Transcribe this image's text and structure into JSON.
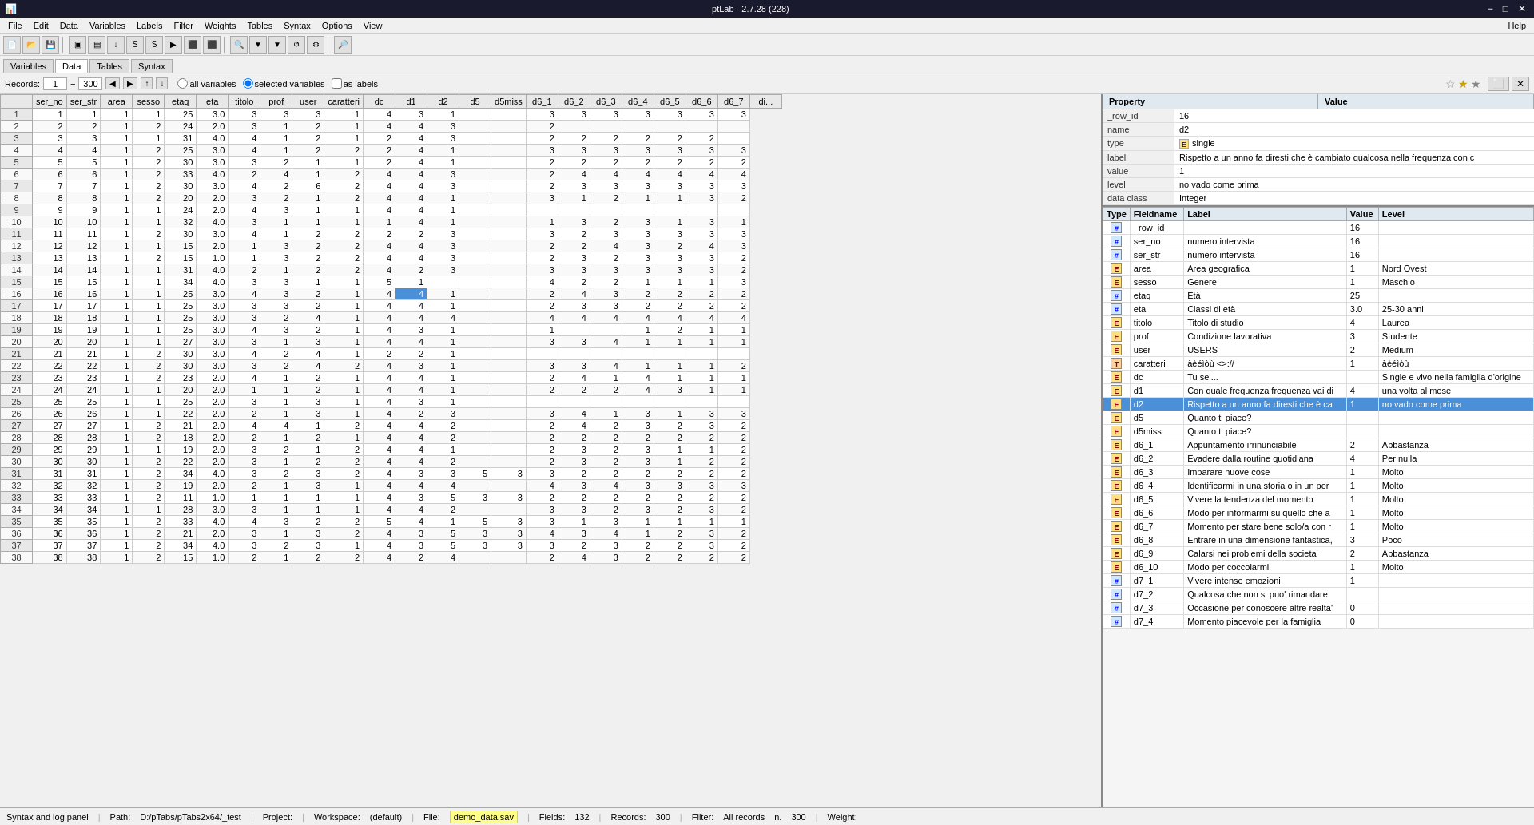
{
  "titlebar": {
    "title": "ptLab - 2.7.28 (228)",
    "minimize": "−",
    "maximize": "□",
    "close": "✕"
  },
  "menu": {
    "items": [
      "File",
      "Edit",
      "Data",
      "Variables",
      "Labels",
      "Filter",
      "Weights",
      "Tables",
      "Syntax",
      "Options",
      "View"
    ],
    "help": "Help"
  },
  "tabs": [
    "Variables",
    "Data",
    "Tables",
    "Syntax"
  ],
  "active_tab": "Data",
  "records": {
    "label": "Records:",
    "from": "1",
    "to": "300",
    "radio_all": "all variables",
    "radio_selected": "selected variables",
    "radio_labels": "as labels"
  },
  "columns": [
    "ser_no",
    "ser_str",
    "area",
    "sesso",
    "etaq",
    "eta",
    "titolo",
    "prof",
    "user",
    "caratteri",
    "dc",
    "d1",
    "d2",
    "d5",
    "d5miss",
    "d6_1",
    "d6_2",
    "d6_3",
    "d6_4",
    "d6_5",
    "d6_6",
    "d6_7",
    "di..."
  ],
  "property_panel": {
    "headers": [
      "Property",
      "Value"
    ],
    "rows": [
      {
        "key": "_row_id",
        "value": "16"
      },
      {
        "key": "name",
        "value": "d2"
      },
      {
        "key": "type",
        "value": "single"
      },
      {
        "key": "label",
        "value": "Rispetto a un anno fa diresti che è cambiato qualcosa nella frequenza con c"
      },
      {
        "key": "value",
        "value": "1"
      },
      {
        "key": "level",
        "value": "no vado come prima"
      },
      {
        "key": "data class",
        "value": "Integer"
      }
    ],
    "type_icon_color": "#ffe080"
  },
  "var_table": {
    "headers": [
      "Type",
      "Fieldname",
      "Label",
      "Value",
      "Level"
    ],
    "rows": [
      {
        "type": "#",
        "fieldname": "_row_id",
        "label": "",
        "value": "16",
        "level": "",
        "selected": false
      },
      {
        "type": "#",
        "fieldname": "ser_no",
        "label": "numero intervista",
        "value": "16",
        "level": "",
        "selected": false
      },
      {
        "type": "#",
        "fieldname": "ser_str",
        "label": "numero intervista",
        "value": "16",
        "level": "",
        "selected": false
      },
      {
        "type": "E",
        "fieldname": "area",
        "label": "Area geografica",
        "value": "1",
        "level": "Nord Ovest",
        "selected": false
      },
      {
        "type": "E",
        "fieldname": "sesso",
        "label": "Genere",
        "value": "1",
        "level": "Maschio",
        "selected": false
      },
      {
        "type": "#",
        "fieldname": "etaq",
        "label": "Età",
        "value": "25",
        "level": "",
        "selected": false
      },
      {
        "type": "#",
        "fieldname": "eta",
        "label": "Classi di età",
        "value": "3.0",
        "level": "25-30 anni",
        "selected": false
      },
      {
        "type": "E",
        "fieldname": "titolo",
        "label": "Titolo di studio",
        "value": "4",
        "level": "Laurea",
        "selected": false
      },
      {
        "type": "E",
        "fieldname": "prof",
        "label": "Condizione lavorativa",
        "value": "3",
        "level": "Studente",
        "selected": false
      },
      {
        "type": "E",
        "fieldname": "user",
        "label": "USERS",
        "value": "2",
        "level": "Medium",
        "selected": false
      },
      {
        "type": "T",
        "fieldname": "caratteri",
        "label": "àèéìòù <>://",
        "value": "1",
        "level": "àèéìòù",
        "selected": false
      },
      {
        "type": "E",
        "fieldname": "dc",
        "label": "Tu sei...",
        "value": "",
        "level": "Single e vivo nella famiglia d'origine",
        "selected": false
      },
      {
        "type": "E",
        "fieldname": "d1",
        "label": "Con quale frequenza frequenza vai di",
        "value": "4",
        "level": "una volta al mese",
        "selected": false
      },
      {
        "type": "E",
        "fieldname": "d2",
        "label": "Rispetto a un anno fa diresti che è ca",
        "value": "1",
        "level": "no vado come prima",
        "selected": true
      },
      {
        "type": "E",
        "fieldname": "d5",
        "label": "Quanto ti piace?",
        "value": "",
        "level": "",
        "selected": false
      },
      {
        "type": "E",
        "fieldname": "d5miss",
        "label": "Quanto ti piace?",
        "value": "",
        "level": "",
        "selected": false
      },
      {
        "type": "E",
        "fieldname": "d6_1",
        "label": "Appuntamento irrinunciabile",
        "value": "2",
        "level": "Abbastanza",
        "selected": false
      },
      {
        "type": "E",
        "fieldname": "d6_2",
        "label": "Evadere dalla routine quotidiana",
        "value": "4",
        "level": "Per nulla",
        "selected": false
      },
      {
        "type": "E",
        "fieldname": "d6_3",
        "label": "Imparare nuove cose",
        "value": "1",
        "level": "Molto",
        "selected": false
      },
      {
        "type": "E",
        "fieldname": "d6_4",
        "label": "Identificarmi in una storia o in un per",
        "value": "1",
        "level": "Molto",
        "selected": false
      },
      {
        "type": "E",
        "fieldname": "d6_5",
        "label": "Vivere la tendenza del momento",
        "value": "1",
        "level": "Molto",
        "selected": false
      },
      {
        "type": "E",
        "fieldname": "d6_6",
        "label": "Modo per informarmi su quello che a",
        "value": "1",
        "level": "Molto",
        "selected": false
      },
      {
        "type": "E",
        "fieldname": "d6_7",
        "label": "Momento per stare bene solo/a con r",
        "value": "1",
        "level": "Molto",
        "selected": false
      },
      {
        "type": "E",
        "fieldname": "d6_8",
        "label": "Entrare in una dimensione fantastica,",
        "value": "3",
        "level": "Poco",
        "selected": false
      },
      {
        "type": "E",
        "fieldname": "d6_9",
        "label": "Calarsi nei problemi della societa'",
        "value": "2",
        "level": "Abbastanza",
        "selected": false
      },
      {
        "type": "E",
        "fieldname": "d6_10",
        "label": "Modo per coccolarmi",
        "value": "1",
        "level": "Molto",
        "selected": false
      },
      {
        "type": "#",
        "fieldname": "d7_1",
        "label": "Vivere intense emozioni",
        "value": "1",
        "level": "",
        "selected": false
      },
      {
        "type": "#",
        "fieldname": "d7_2",
        "label": "Qualcosa che non si puo' rimandare",
        "value": "",
        "level": "",
        "selected": false
      },
      {
        "type": "#",
        "fieldname": "d7_3",
        "label": "Occasione per conoscere altre realta'",
        "value": "0",
        "level": "",
        "selected": false
      },
      {
        "type": "#",
        "fieldname": "d7_4",
        "label": "Momento piacevole per la famiglia",
        "value": "0",
        "level": "",
        "selected": false
      }
    ]
  },
  "data_rows": [
    [
      1,
      1,
      1,
      1,
      25,
      "3.0",
      3,
      3,
      3,
      1,
      4,
      3,
      1,
      "",
      "",
      3,
      3,
      3,
      3,
      3,
      3,
      3
    ],
    [
      2,
      2,
      1,
      2,
      24,
      "2.0",
      3,
      1,
      2,
      1,
      4,
      4,
      3,
      "",
      "",
      2,
      "",
      "",
      "",
      "",
      "",
      ""
    ],
    [
      3,
      3,
      1,
      1,
      31,
      "4.0",
      4,
      1,
      2,
      1,
      2,
      4,
      3,
      "",
      "",
      2,
      2,
      2,
      2,
      2,
      2,
      ""
    ],
    [
      4,
      4,
      1,
      2,
      25,
      "3.0",
      4,
      1,
      2,
      2,
      2,
      4,
      1,
      "",
      "",
      3,
      3,
      3,
      3,
      3,
      3,
      3
    ],
    [
      5,
      5,
      1,
      2,
      30,
      "3.0",
      3,
      2,
      1,
      1,
      2,
      4,
      1,
      "",
      "",
      2,
      2,
      2,
      2,
      2,
      2,
      2
    ],
    [
      6,
      6,
      1,
      2,
      33,
      "4.0",
      2,
      4,
      1,
      2,
      4,
      4,
      3,
      "",
      "",
      2,
      4,
      4,
      4,
      4,
      4,
      4
    ],
    [
      7,
      7,
      1,
      2,
      30,
      "3.0",
      4,
      2,
      6,
      2,
      4,
      4,
      3,
      "",
      "",
      2,
      3,
      3,
      3,
      3,
      3,
      3
    ],
    [
      8,
      8,
      1,
      2,
      20,
      "2.0",
      3,
      2,
      1,
      2,
      4,
      4,
      1,
      "",
      "",
      3,
      1,
      2,
      1,
      1,
      3,
      2
    ],
    [
      9,
      9,
      1,
      1,
      24,
      "2.0",
      4,
      3,
      1,
      1,
      4,
      4,
      1,
      "",
      "",
      "",
      "",
      "",
      "",
      "",
      "",
      ""
    ],
    [
      10,
      10,
      1,
      1,
      32,
      "4.0",
      3,
      1,
      1,
      1,
      1,
      4,
      1,
      "",
      "",
      1,
      3,
      2,
      3,
      1,
      3,
      1
    ],
    [
      11,
      11,
      1,
      2,
      30,
      "3.0",
      4,
      1,
      2,
      2,
      2,
      2,
      3,
      "",
      "",
      3,
      2,
      3,
      3,
      3,
      3,
      3
    ],
    [
      12,
      12,
      1,
      1,
      15,
      "2.0",
      1,
      3,
      2,
      2,
      4,
      4,
      3,
      "",
      "",
      2,
      2,
      4,
      3,
      2,
      4,
      3
    ],
    [
      13,
      13,
      1,
      2,
      15,
      "1.0",
      1,
      3,
      2,
      2,
      4,
      4,
      3,
      "",
      "",
      2,
      3,
      2,
      3,
      3,
      3,
      2
    ],
    [
      14,
      14,
      1,
      1,
      31,
      "4.0",
      2,
      1,
      2,
      2,
      4,
      2,
      3,
      "",
      "",
      3,
      3,
      3,
      3,
      3,
      3,
      2
    ],
    [
      15,
      15,
      1,
      1,
      34,
      "4.0",
      3,
      3,
      1,
      1,
      5,
      1,
      "",
      "",
      "",
      4,
      2,
      2,
      1,
      1,
      1,
      3
    ],
    [
      16,
      16,
      1,
      1,
      25,
      "3.0",
      4,
      3,
      2,
      1,
      4,
      4,
      1,
      "",
      "",
      2,
      4,
      3,
      2,
      2,
      2,
      2
    ],
    [
      17,
      17,
      1,
      1,
      25,
      "3.0",
      3,
      3,
      2,
      1,
      4,
      4,
      1,
      "",
      "",
      2,
      3,
      3,
      2,
      2,
      2,
      2
    ],
    [
      18,
      18,
      1,
      1,
      25,
      "3.0",
      3,
      2,
      4,
      1,
      4,
      4,
      4,
      "",
      "",
      4,
      4,
      4,
      4,
      4,
      4,
      4
    ],
    [
      19,
      19,
      1,
      1,
      25,
      "3.0",
      4,
      3,
      2,
      1,
      4,
      3,
      1,
      "",
      "",
      1,
      "",
      "",
      1,
      2,
      1,
      1
    ],
    [
      20,
      20,
      1,
      1,
      27,
      "3.0",
      3,
      1,
      3,
      1,
      4,
      4,
      1,
      "",
      "",
      3,
      3,
      4,
      1,
      1,
      1,
      1
    ],
    [
      21,
      21,
      1,
      2,
      30,
      "3.0",
      4,
      2,
      4,
      1,
      2,
      2,
      1,
      "",
      "",
      "",
      "",
      "",
      "",
      "",
      "",
      ""
    ],
    [
      22,
      22,
      1,
      2,
      30,
      "3.0",
      3,
      2,
      4,
      2,
      4,
      3,
      1,
      "",
      "",
      3,
      3,
      4,
      1,
      1,
      1,
      2
    ],
    [
      23,
      23,
      1,
      2,
      23,
      "2.0",
      4,
      1,
      2,
      1,
      4,
      4,
      1,
      "",
      "",
      2,
      4,
      1,
      4,
      1,
      1,
      1
    ],
    [
      24,
      24,
      1,
      1,
      20,
      "2.0",
      1,
      1,
      2,
      1,
      4,
      4,
      1,
      "",
      "",
      2,
      2,
      2,
      4,
      3,
      1,
      1
    ],
    [
      25,
      25,
      1,
      1,
      25,
      "2.0",
      3,
      1,
      3,
      1,
      4,
      3,
      1,
      "",
      "",
      "",
      "",
      "",
      "",
      "",
      "",
      ""
    ],
    [
      26,
      26,
      1,
      1,
      22,
      "2.0",
      2,
      1,
      3,
      1,
      4,
      2,
      3,
      "",
      "",
      3,
      4,
      1,
      3,
      1,
      3,
      3
    ],
    [
      27,
      27,
      1,
      2,
      21,
      "2.0",
      4,
      4,
      1,
      2,
      4,
      4,
      2,
      "",
      "",
      2,
      4,
      2,
      3,
      2,
      3,
      2
    ],
    [
      28,
      28,
      1,
      2,
      18,
      "2.0",
      2,
      1,
      2,
      1,
      4,
      4,
      2,
      "",
      "",
      2,
      2,
      2,
      2,
      2,
      2,
      2
    ],
    [
      29,
      29,
      1,
      1,
      19,
      "2.0",
      3,
      2,
      1,
      2,
      4,
      4,
      1,
      "",
      "",
      2,
      3,
      2,
      3,
      1,
      1,
      2
    ],
    [
      30,
      30,
      1,
      2,
      22,
      "2.0",
      3,
      1,
      2,
      2,
      4,
      4,
      2,
      "",
      "",
      2,
      3,
      2,
      3,
      1,
      2,
      2
    ],
    [
      31,
      31,
      1,
      2,
      34,
      "4.0",
      3,
      2,
      3,
      2,
      4,
      3,
      3,
      5,
      3,
      3,
      2,
      2,
      2,
      2,
      2,
      2
    ],
    [
      32,
      32,
      1,
      2,
      19,
      "2.0",
      2,
      1,
      3,
      1,
      4,
      4,
      4,
      "",
      "",
      4,
      3,
      4,
      3,
      3,
      3,
      3
    ],
    [
      33,
      33,
      1,
      2,
      11,
      "1.0",
      1,
      1,
      1,
      1,
      4,
      3,
      5,
      3,
      3,
      2,
      2,
      2,
      2,
      2,
      2,
      2
    ],
    [
      34,
      34,
      1,
      1,
      28,
      "3.0",
      3,
      1,
      1,
      1,
      4,
      4,
      2,
      "",
      "",
      3,
      3,
      2,
      3,
      2,
      3,
      2
    ],
    [
      35,
      35,
      1,
      2,
      33,
      "4.0",
      4,
      3,
      2,
      2,
      5,
      4,
      1,
      5,
      3,
      3,
      1,
      3,
      1,
      1,
      1,
      1
    ],
    [
      36,
      36,
      1,
      2,
      21,
      "2.0",
      3,
      1,
      3,
      2,
      4,
      3,
      5,
      3,
      3,
      4,
      3,
      4,
      1,
      2,
      3,
      2
    ],
    [
      37,
      37,
      1,
      2,
      34,
      "4.0",
      3,
      2,
      3,
      1,
      4,
      3,
      5,
      3,
      3,
      3,
      2,
      3,
      2,
      2,
      3,
      2
    ],
    [
      38,
      38,
      1,
      2,
      15,
      "1.0",
      2,
      1,
      2,
      2,
      4,
      2,
      4,
      "",
      "",
      2,
      4,
      3,
      2,
      2,
      2,
      2
    ]
  ],
  "statusbar": {
    "left": "Syntax and log panel",
    "path_label": "Path:",
    "path_value": "D:/pTabs/pTabs2x64/_test",
    "project_label": "Project:",
    "project_value": "",
    "workspace_label": "Workspace:",
    "workspace_value": "(default)",
    "file_label": "File:",
    "file_value": "demo_data.sav",
    "fields_label": "Fields:",
    "fields_value": "132",
    "records_label": "Records:",
    "records_value": "300",
    "filter_label": "Filter:",
    "filter_value": "All records",
    "n_label": "n.",
    "n_value": "300",
    "weight_label": "Weight:"
  }
}
